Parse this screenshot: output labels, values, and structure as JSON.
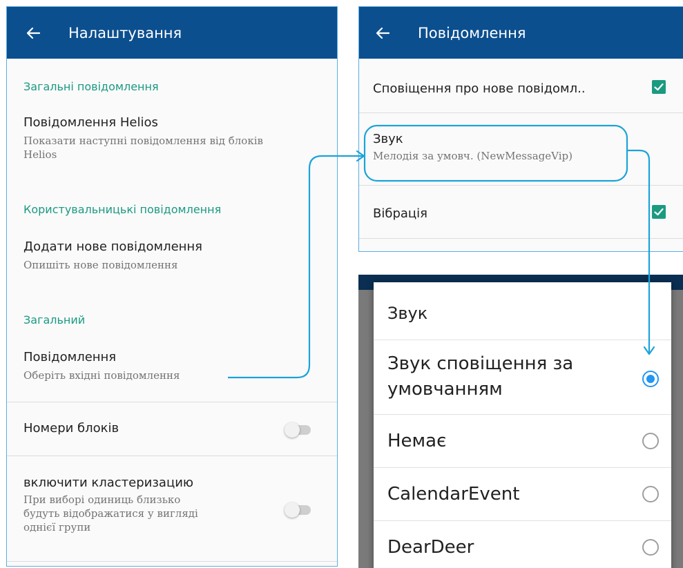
{
  "settings": {
    "title": "Налаштування",
    "sections": {
      "general_notifications": "Загальні повідомлення",
      "user_notifications": "Користувальницькі повідомлення",
      "general": "Загальний"
    },
    "helios": {
      "title": "Повідомлення Helios",
      "summary_line1": "Показати наступні повідомлення від блоків",
      "summary_line2": "Helios"
    },
    "add_new": {
      "title": "Додати нове повідомлення",
      "summary": "Опишіть нове повідомлення"
    },
    "notifications": {
      "title": "Повідомлення",
      "summary": "Оберіть вхідні повідомлення"
    },
    "block_numbers": {
      "title": "Номери блоків",
      "enabled": false
    },
    "clustering": {
      "title": "включити кластеризацию",
      "summary_line1": "При виборі одиниць близько",
      "summary_line2": "будуть відображатися у вигляді",
      "summary_line3": "однієї групи",
      "enabled": false
    }
  },
  "notifications_screen": {
    "title": "Повідомлення",
    "new_message_alert": {
      "title": "Сповіщення про нове повідомл..",
      "checked": true
    },
    "sound": {
      "title": "Звук",
      "summary": "Мелодія за умовч. (NewMessageVip)"
    },
    "vibration": {
      "title": "Вібрація",
      "checked": true
    }
  },
  "sound_dialog": {
    "title": "Звук",
    "options": [
      {
        "label_line1": "Звук сповіщення за",
        "label_line2": "умовчанням",
        "selected": true
      },
      {
        "label_line1": "Немає",
        "selected": false
      },
      {
        "label_line1": "CalendarEvent",
        "selected": false
      },
      {
        "label_line1": "DearDeer",
        "selected": false
      }
    ]
  },
  "colors": {
    "appbar": "#0c4f8f",
    "accent_teal": "#1b9a82",
    "radio_blue": "#2196f3",
    "annotation": "#1aa3d9"
  },
  "icons": {
    "back": "arrow-left-icon",
    "checkbox": "checkbox-checked-icon",
    "radio": "radio-icon",
    "switch": "toggle-switch-icon"
  }
}
